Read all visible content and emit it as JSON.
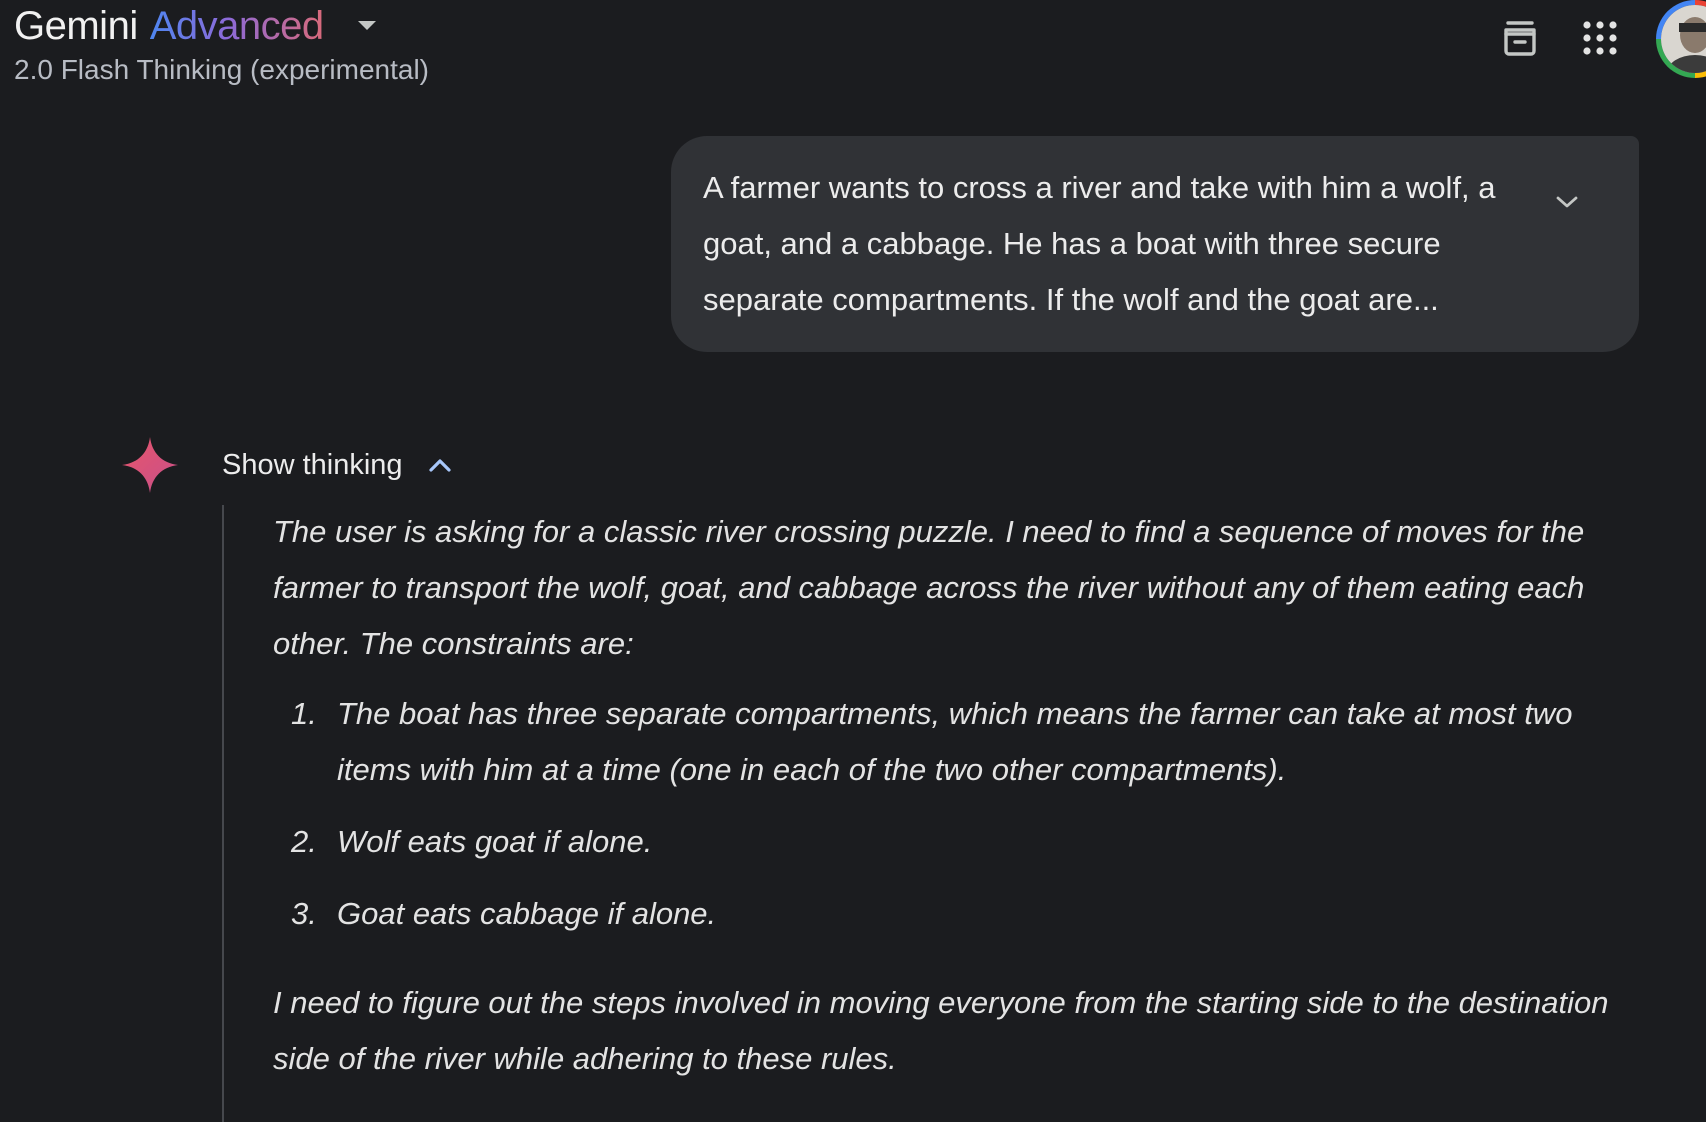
{
  "header": {
    "brand_name": "Gemini",
    "brand_tier": "Advanced",
    "model_subtitle": "2.0 Flash Thinking (experimental)"
  },
  "icons": {
    "model_dropdown": "caret-down-icon",
    "archive": "archive-icon",
    "apps": "apps-grid-icon",
    "avatar": "user-avatar",
    "expand_prompt": "chevron-down-icon",
    "spark": "gemini-spark-icon",
    "collapse_thinking": "chevron-up-icon"
  },
  "colors": {
    "background": "#1b1c1f",
    "bubble": "#303236",
    "accent_blue": "#4f86f0",
    "accent_pink": "#d96a7a",
    "thinking_chevron": "#a8c7fa"
  },
  "user_message": {
    "text": "A farmer wants to cross a river and take with him a wolf, a goat, and a cabbage. He has a boat with three secure separate compartments. If the wolf and the goat are..."
  },
  "response": {
    "thinking_label": "Show thinking",
    "intro": "The user is asking for a classic river crossing puzzle. I need to find a sequence of moves for the farmer to transport the wolf, goat, and cabbage across the river without any of them eating each other. The constraints are:",
    "constraints": [
      {
        "num": "1.",
        "text": "The boat has three separate compartments, which means the farmer can take at most two items with him at a time (one in each of the two other compartments)."
      },
      {
        "num": "2.",
        "text": "Wolf eats goat if alone."
      },
      {
        "num": "3.",
        "text": "Goat eats cabbage if alone."
      }
    ],
    "conclusion": "I need to figure out the steps involved in moving everyone from the starting side to the destination side of the river while adhering to these rules."
  }
}
